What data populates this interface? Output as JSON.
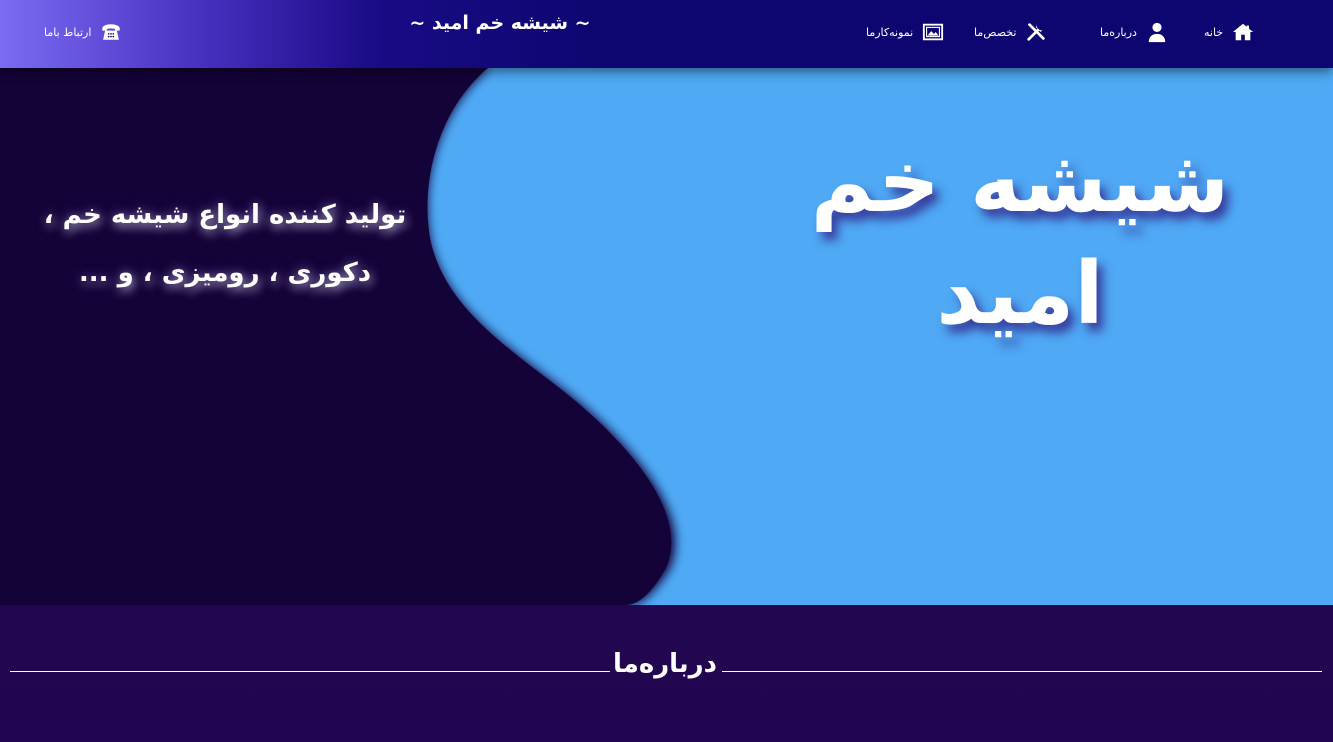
{
  "header": {
    "site_title": "~ شیشه خم امید ~",
    "contact": {
      "label": "ارتباط باما",
      "icon": "phone-icon"
    },
    "nav": [
      {
        "label": "خانه",
        "icon": "home-icon"
      },
      {
        "label": "درباره‌ما",
        "icon": "user-icon"
      },
      {
        "label": "تخصص‌ما",
        "icon": "tools-icon"
      },
      {
        "label": "نمونه‌کارما",
        "icon": "gallery-icon"
      }
    ]
  },
  "hero": {
    "title_line1": "شیشه خم",
    "title_line2": "امید",
    "subtitle_line1": "تولید کننده انواع شیشه خم ،",
    "subtitle_line2": "دکوری ، رومیزی ، و ..."
  },
  "about": {
    "title": "درباره‌ما"
  },
  "colors": {
    "header_dark": "#0d0670",
    "header_light": "#7b6cf2",
    "hero_blue": "#4fa9f5",
    "hero_dark": "#140338",
    "about_bg": "#22064e"
  }
}
